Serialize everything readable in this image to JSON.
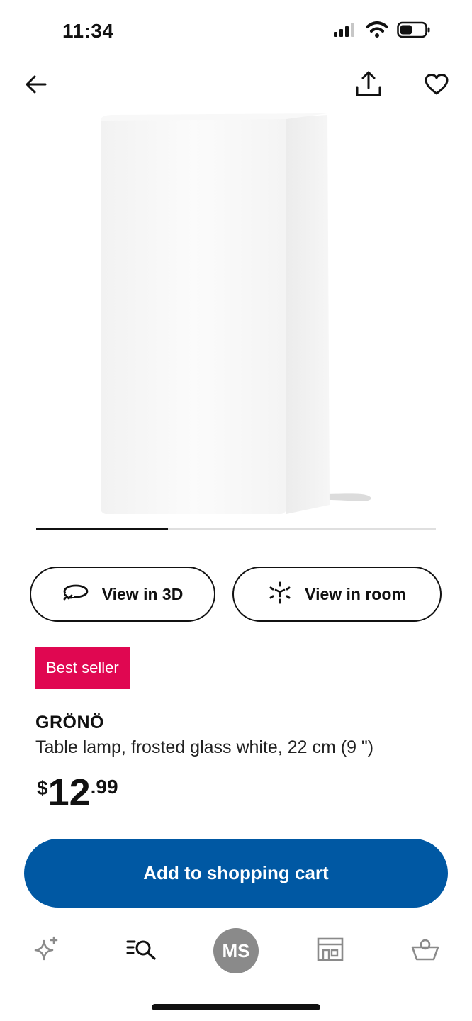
{
  "status_bar": {
    "time": "11:34",
    "icons": [
      "cellular-signal-icon",
      "wifi-icon",
      "battery-icon"
    ]
  },
  "nav": {
    "icons": [
      "arrow-left-icon",
      "share-icon",
      "heart-icon"
    ]
  },
  "gallery": {
    "current_image": 1,
    "progress_fraction": 0.33
  },
  "actions": {
    "view_3d_label": "View in 3D",
    "view_room_label": "View in room"
  },
  "product": {
    "badge": "Best seller",
    "name": "GRÖNÖ",
    "description": "Table lamp, frosted glass white, 22 cm (9 \")",
    "price_currency": "$",
    "price_integer": "12",
    "price_cents": ".99"
  },
  "cart_button": {
    "label": "Add to shopping cart"
  },
  "tab_bar": {
    "profile_initials": "MS",
    "icons": [
      "sparkle-icon",
      "search-list-icon",
      "avatar",
      "store-icon",
      "basket-icon"
    ]
  },
  "colors": {
    "brand_blue": "#0058a3",
    "badge_red": "#e00751",
    "avatar_grey": "#8a8a8a"
  }
}
